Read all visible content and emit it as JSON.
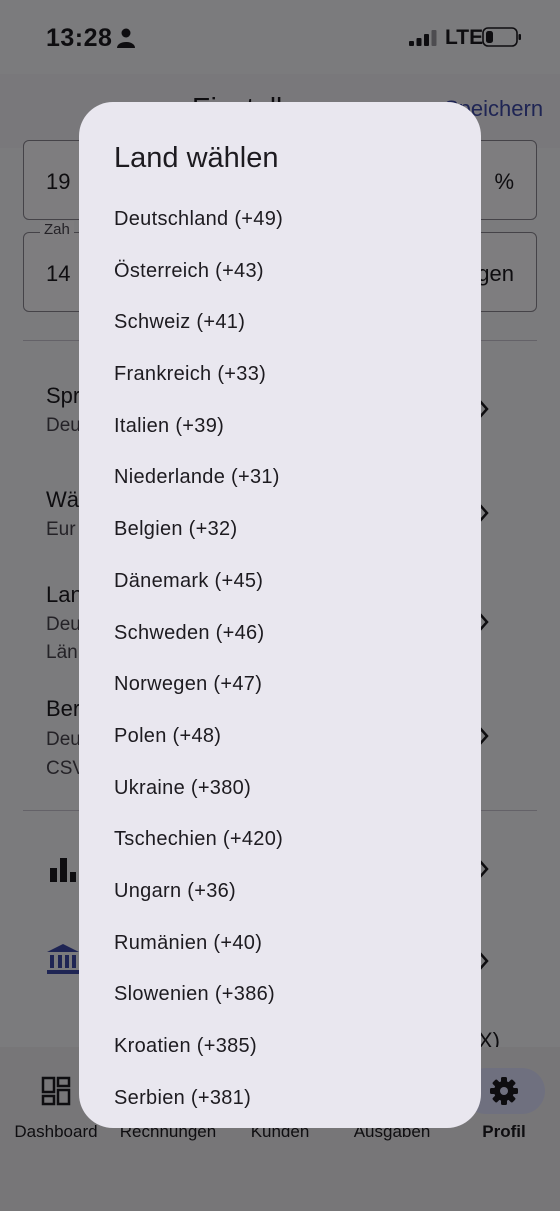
{
  "status_bar": {
    "time": "13:28",
    "network": "LTE"
  },
  "header": {
    "title": "Einstell",
    "save_label": "Speichern"
  },
  "form": {
    "tax_field": {
      "value": "19",
      "suffix": "%"
    },
    "payment_field": {
      "label": "Zah",
      "value": "14",
      "suffix": "gen"
    }
  },
  "settings_rows": [
    {
      "title": "Spr",
      "sub": "Deu"
    },
    {
      "title": "Wä",
      "sub": "Eur"
    },
    {
      "title": "Lan",
      "sub": "Deu",
      "sub2": "Län"
    },
    {
      "title": "Ber",
      "sub": "Deu",
      "sub2": "CSV"
    }
  ],
  "background_fragment": "X)",
  "bottom_nav": {
    "items": [
      {
        "label": "Dashboard",
        "icon": "dashboard-icon"
      },
      {
        "label": "Rechnungen",
        "icon": "invoice-icon"
      },
      {
        "label": "Kunden",
        "icon": "customers-icon"
      },
      {
        "label": "Ausgaben",
        "icon": "expenses-icon"
      },
      {
        "label": "Profil",
        "icon": "gear-icon",
        "active": true
      }
    ]
  },
  "dialog": {
    "title": "Land wählen",
    "countries": [
      "Deutschland (+49)",
      "Österreich (+43)",
      "Schweiz (+41)",
      "Frankreich (+33)",
      "Italien (+39)",
      "Niederlande (+31)",
      "Belgien (+32)",
      "Dänemark (+45)",
      "Schweden (+46)",
      "Norwegen (+47)",
      "Polen (+48)",
      "Ukraine (+380)",
      "Tschechien (+420)",
      "Ungarn (+36)",
      "Rumänien (+40)",
      "Slowenien (+386)",
      "Kroatien (+385)",
      "Serbien (+381)"
    ]
  },
  "colors": {
    "accent": "#3f4aa8",
    "dialog_bg": "#e9e7ef",
    "scrim": "rgba(0,0,0,0.5)"
  }
}
